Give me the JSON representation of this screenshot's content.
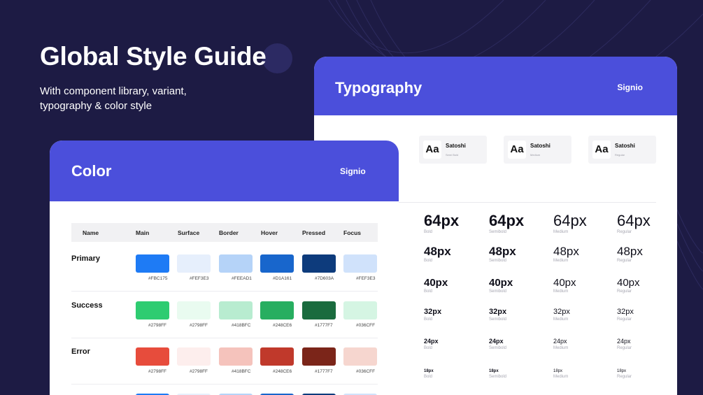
{
  "hero": {
    "title": "Global Style Guide",
    "subtitle": "With component library, variant, typography & color style"
  },
  "typography": {
    "title": "Typography",
    "brand": "Signio",
    "font_samples": [
      {
        "glyph": "Aa",
        "name": "Satoshi",
        "weight": "Semi Bold"
      },
      {
        "glyph": "Aa",
        "name": "Satoshi",
        "weight": "Medium"
      },
      {
        "glyph": "Aa",
        "name": "Satoshi",
        "weight": "Regular"
      }
    ],
    "weights": [
      "Bold",
      "Semibold",
      "Medium",
      "Regular"
    ],
    "sizes": [
      "64px",
      "48px",
      "40px",
      "32px",
      "24px",
      "18px"
    ]
  },
  "color": {
    "title": "Color",
    "brand": "Signio",
    "columns": [
      "Name",
      "Main",
      "Surface",
      "Border",
      "Hover",
      "Pressed",
      "Focus"
    ],
    "rows": [
      {
        "name": "Primary",
        "swatches": [
          "#1e7bf5",
          "#e6effc",
          "#b5d3f8",
          "#1866cc",
          "#0d3b7c",
          "#d0e2fb"
        ],
        "hex_labels": [
          "#FBC175",
          "#FEF3E3",
          "#FEEAD1",
          "#D1A161",
          "#7D603A",
          "#FEF3E3"
        ]
      },
      {
        "name": "Success",
        "swatches": [
          "#2ecc71",
          "#e9fbf0",
          "#b8ecd0",
          "#27ae60",
          "#1a6b3e",
          "#d5f5e3"
        ],
        "hex_labels": [
          "#2798FF",
          "#2798FF",
          "#418BFC",
          "#248CE6",
          "#1777F7",
          "#036CFF"
        ]
      },
      {
        "name": "Error",
        "swatches": [
          "#e74c3c",
          "#fdeeed",
          "#f5c3bc",
          "#c0392b",
          "#7b2519",
          "#f6d6cf"
        ],
        "hex_labels": [
          "#2798FF",
          "#2798FF",
          "#418BFC",
          "#248CE6",
          "#1777F7",
          "#036CFF"
        ]
      }
    ],
    "partial_row_swatches": [
      "#1e7bf5",
      "#e6effc",
      "#b5d3f8",
      "#1866cc",
      "#0d3b7c",
      "#d0e2fb"
    ]
  },
  "colors": {
    "background": "#1d1b44",
    "accent": "#4b4fdb"
  }
}
